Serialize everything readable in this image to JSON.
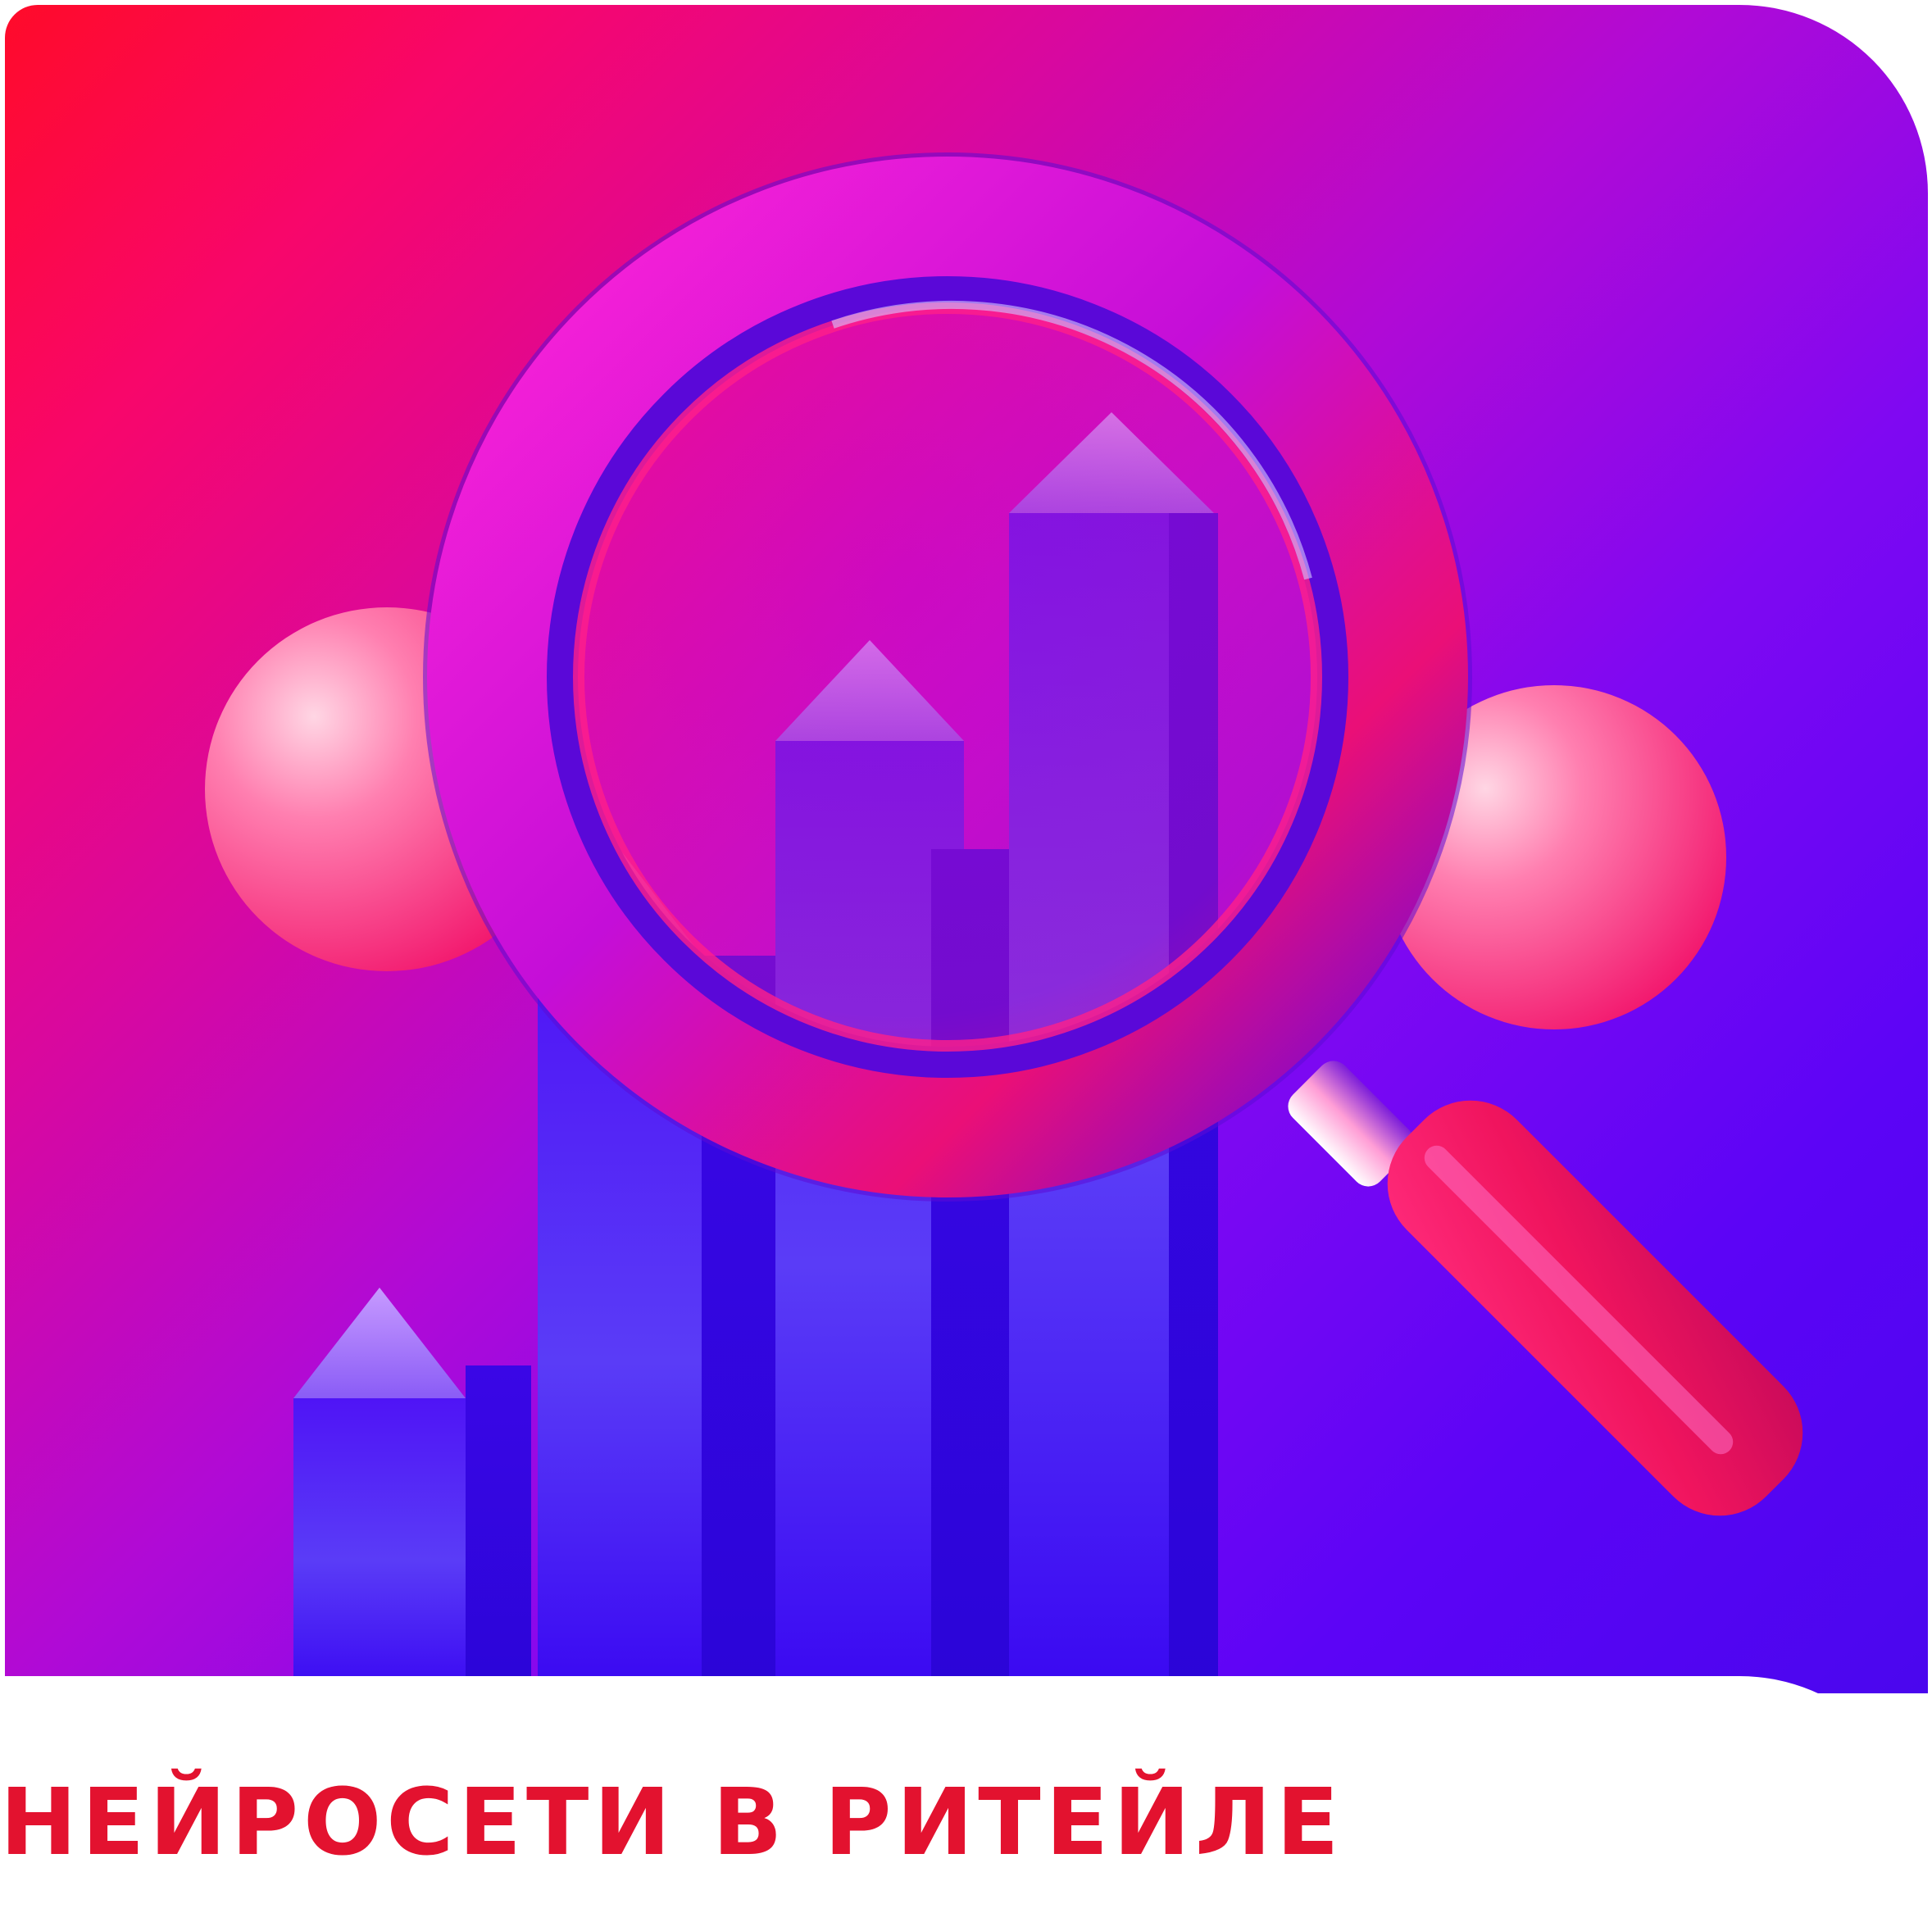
{
  "banner": {
    "headline": "НЕЙРОСЕТИ В РИТЕЙЛЕ",
    "colors": {
      "gradient_start": "#ff0b29",
      "gradient_mid": "#b00ad6",
      "gradient_end": "#4a06ee",
      "headline": "#e3122f",
      "lens_ring": "#e20d8e",
      "handle": "#f21869",
      "bars": "#4a0ef5"
    }
  },
  "illustration": {
    "main_icon": "magnifying-glass-icon",
    "chart_icon": "bar-chart-arrows-icon",
    "bar_count": 5,
    "sphere_count": 2
  }
}
